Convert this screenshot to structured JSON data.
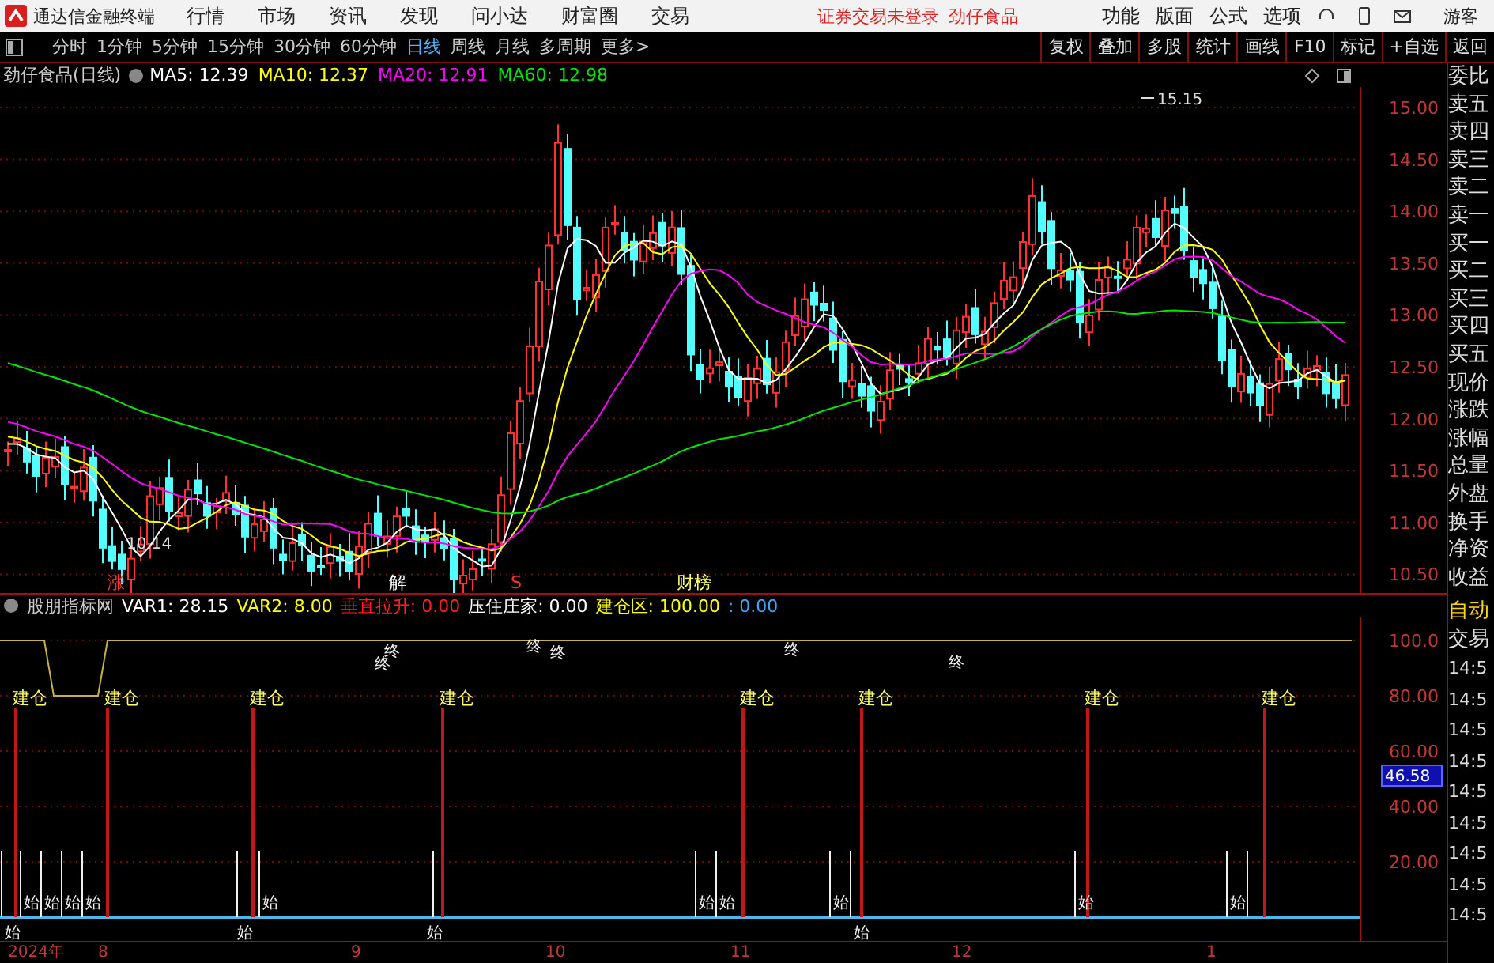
{
  "app_bar": {
    "title": "通达信金融终端",
    "menu": [
      "行情",
      "市场",
      "资讯",
      "发现",
      "问小达",
      "财富圈",
      "交易"
    ],
    "notice": "证券交易未登录",
    "stock": "劲仔食品",
    "right_menu": [
      "功能",
      "版面",
      "公式",
      "选项"
    ],
    "user": "游客"
  },
  "period_tabs": [
    {
      "label": "分时",
      "selected": false
    },
    {
      "label": "1分钟",
      "selected": false
    },
    {
      "label": "5分钟",
      "selected": false
    },
    {
      "label": "15分钟",
      "selected": false
    },
    {
      "label": "30分钟",
      "selected": false
    },
    {
      "label": "60分钟",
      "selected": false
    },
    {
      "label": "日线",
      "selected": true
    },
    {
      "label": "周线",
      "selected": false
    },
    {
      "label": "月线",
      "selected": false
    },
    {
      "label": "多周期",
      "selected": false
    },
    {
      "label": "更多>",
      "selected": false
    }
  ],
  "tools": [
    "复权",
    "叠加",
    "多股",
    "统计",
    "画线",
    "F10",
    "标记",
    "+自选",
    "返回"
  ],
  "main_chart": {
    "title": "劲仔食品(日线)",
    "ma": [
      {
        "label": "MA5: 12.39",
        "color": "#ffffff"
      },
      {
        "label": "MA10: 12.37",
        "color": "#ffff00"
      },
      {
        "label": "MA20: 12.91",
        "color": "#ff00ff"
      },
      {
        "label": "MA60: 12.98",
        "color": "#00e600"
      }
    ],
    "price_ticks": [
      "15.00",
      "14.50",
      "14.00",
      "13.50",
      "13.00",
      "12.50",
      "12.00",
      "11.50",
      "11.00",
      "10.50"
    ],
    "high_label": "15.15",
    "low_label": "10.14",
    "events": [
      {
        "text": "涨",
        "color": "#ff3232"
      },
      {
        "text": "解",
        "color": "#ffffff"
      },
      {
        "text": "S",
        "color": "#ff3232"
      },
      {
        "text": "财榜",
        "color": "#ffff66"
      }
    ]
  },
  "indicator": {
    "name": "股朋指标网",
    "values": [
      {
        "text": "VAR1: 28.15",
        "color": "#ffffff"
      },
      {
        "text": "VAR2: 8.00",
        "color": "#ffff00"
      },
      {
        "text": "垂直拉升: 0.00",
        "color": "#ff2020"
      },
      {
        "text": "压住庄家: 0.00",
        "color": "#ffffff"
      },
      {
        "text": "建仓区: 100.00",
        "color": "#ffff00"
      },
      {
        "text": ": 0.00",
        "color": "#3aa8ff"
      }
    ],
    "ticks": [
      "100.0",
      "80.00",
      "60.00",
      "40.00",
      "20.00"
    ],
    "current": "46.58",
    "build_marks": [
      "建仓",
      "建仓",
      "建仓",
      "建仓",
      "建仓",
      "建仓",
      "建仓",
      "建仓"
    ],
    "end_marks": [
      "终",
      "终",
      "终",
      "终",
      "终",
      "终"
    ],
    "start_marks": [
      "始",
      "始",
      "始",
      "始",
      "始",
      "始",
      "始",
      "始",
      "始",
      "始",
      "始",
      "始",
      "始",
      "始"
    ]
  },
  "time_axis": [
    "2024年",
    "8",
    "9",
    "10",
    "11",
    "12",
    "1"
  ],
  "quote_panel": [
    "委比",
    "卖五",
    "卖四",
    "卖三",
    "卖二",
    "卖一",
    "买一",
    "买二",
    "买三",
    "买四",
    "买五",
    "现价",
    "涨跌",
    "涨幅",
    "总量",
    "外盘",
    "换手",
    "净资",
    "收益"
  ],
  "trade_panel": {
    "labels": [
      "自动",
      "交易"
    ],
    "times": [
      "14:5",
      "14:5",
      "14:5",
      "14:5",
      "14:5",
      "14:5",
      "14:5",
      "14:5",
      "14:5"
    ]
  }
}
